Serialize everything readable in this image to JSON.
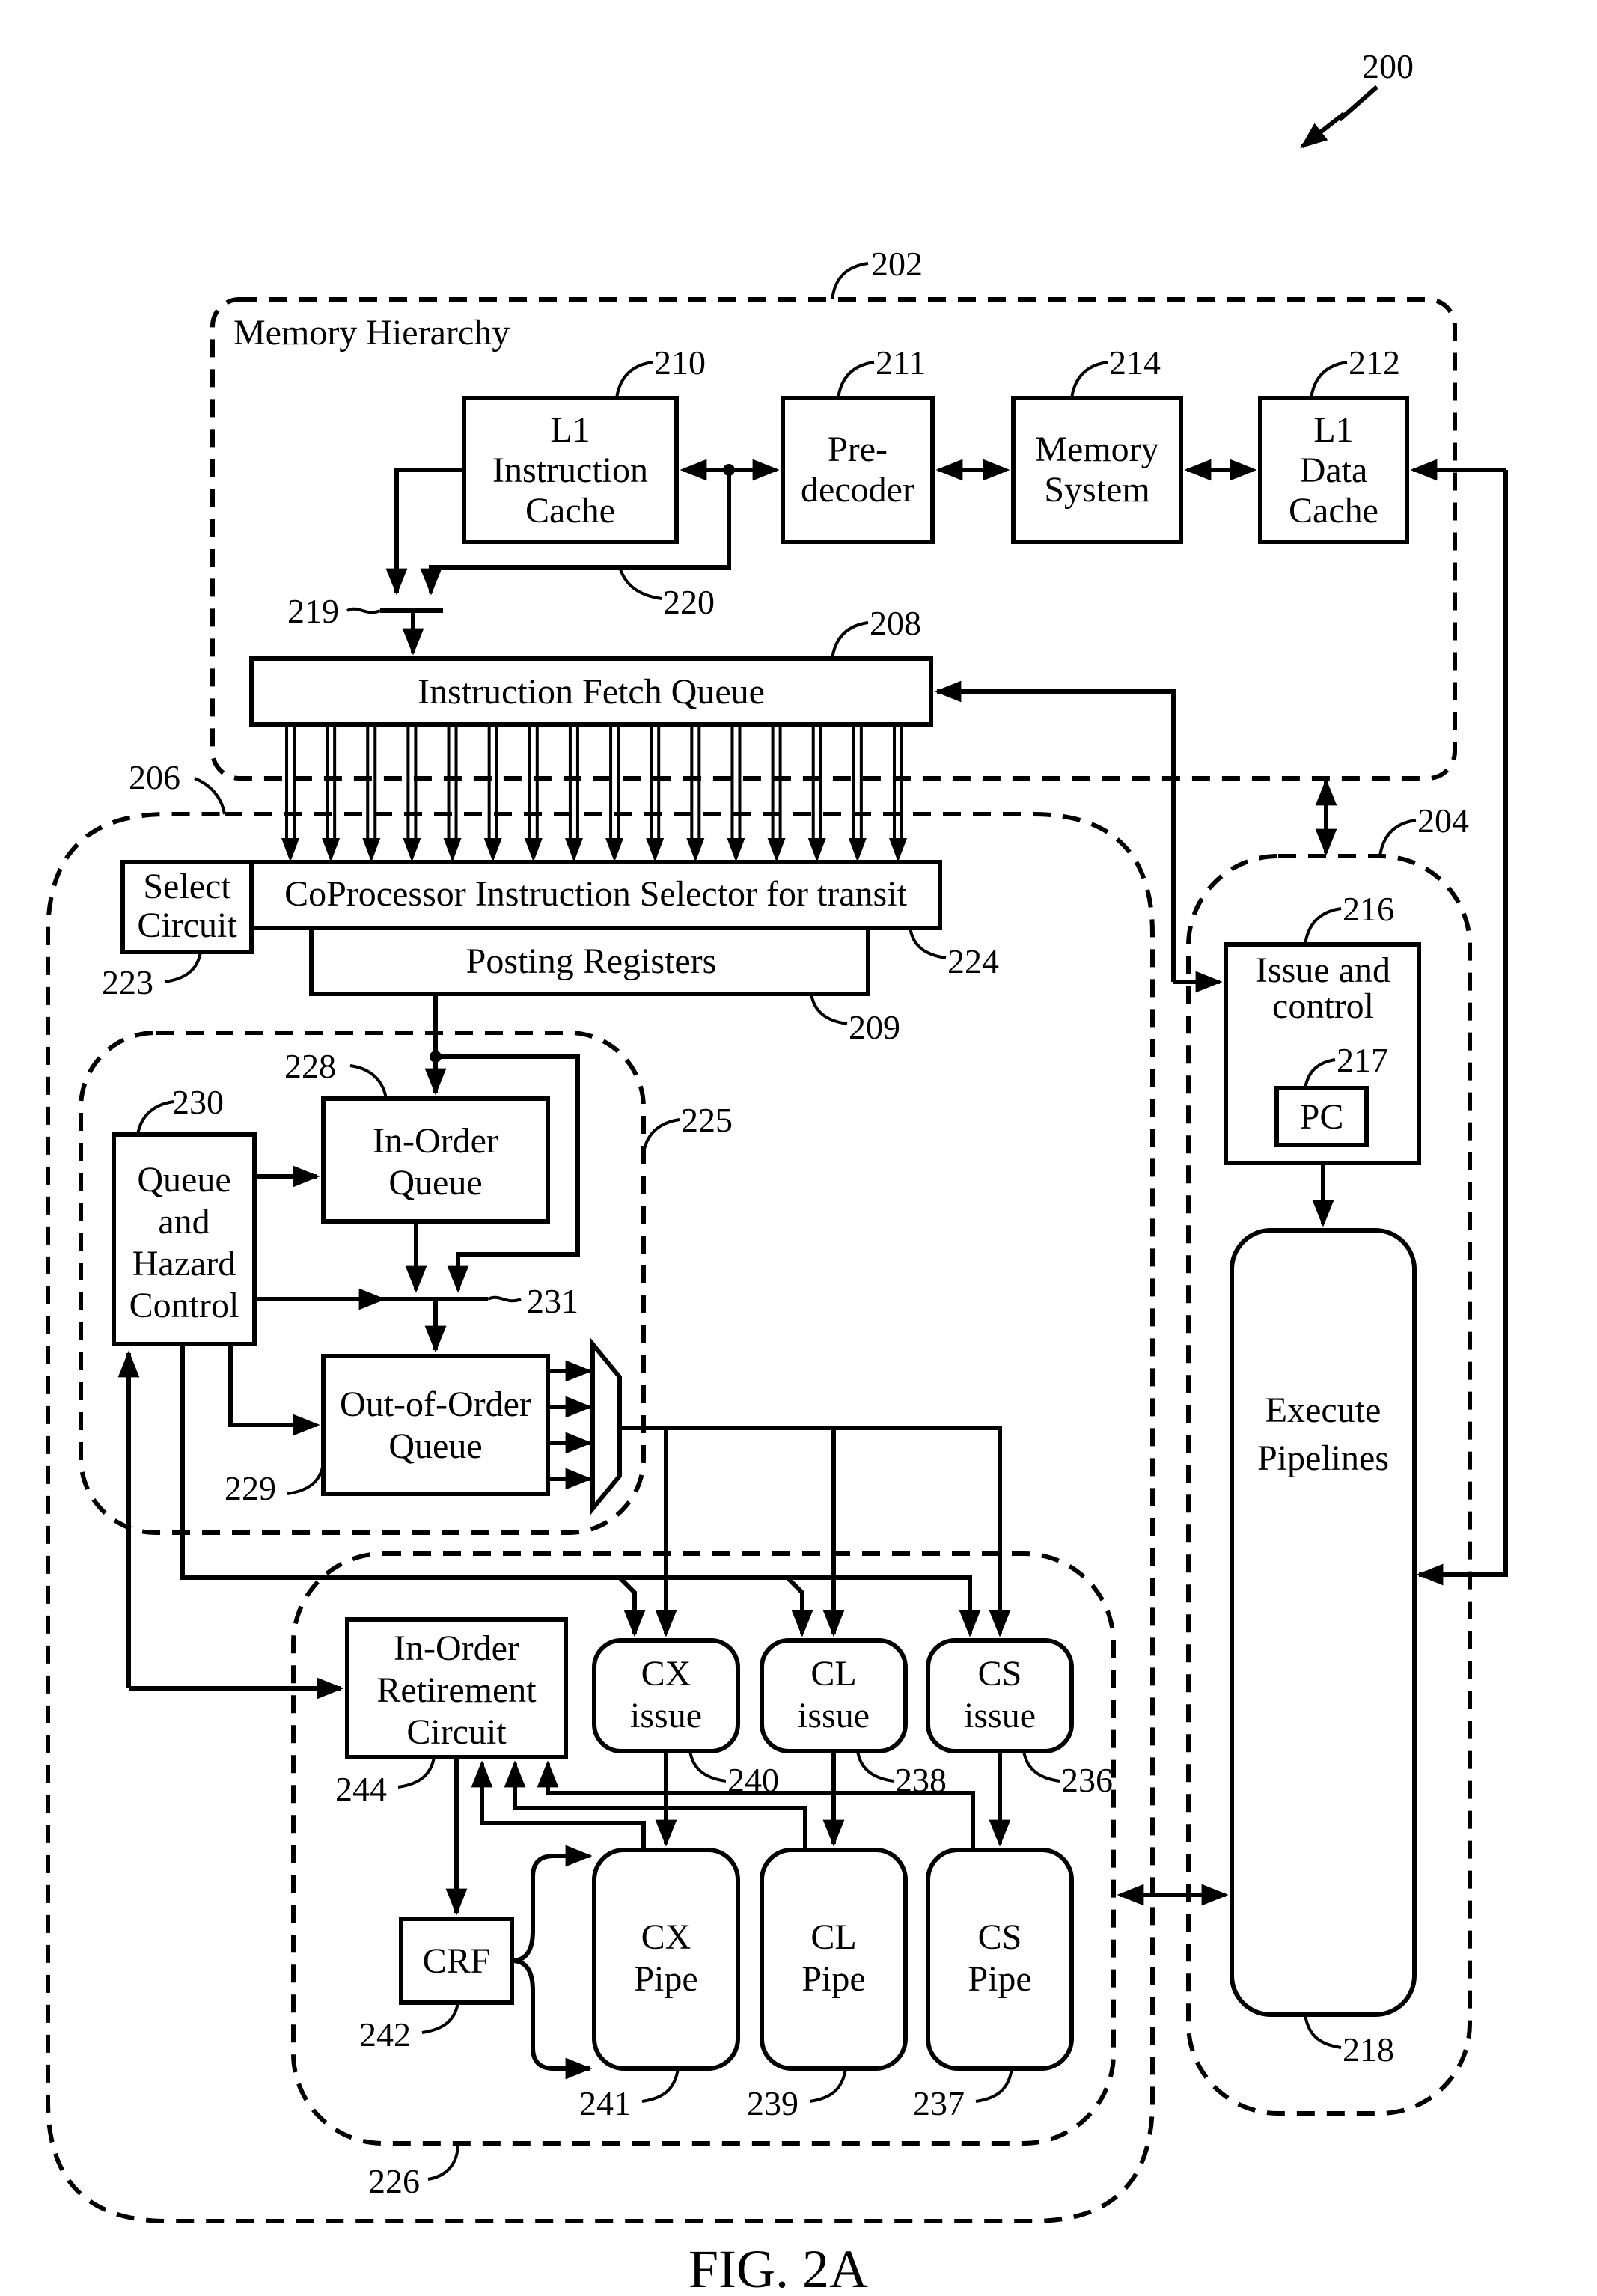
{
  "figure": {
    "caption": "FIG. 2A",
    "reference": "200"
  },
  "regions": {
    "memory_hierarchy": {
      "title": "Memory Hierarchy",
      "ref": "202"
    },
    "processor": {
      "ref": "204"
    },
    "coprocessor": {
      "ref": "206"
    },
    "queue_region": {
      "ref": "225"
    },
    "execution_region": {
      "ref": "226"
    }
  },
  "blocks": {
    "l1_icache": {
      "lines": [
        "L1",
        "Instruction",
        "Cache"
      ],
      "ref": "210"
    },
    "predecoder": {
      "lines": [
        "Pre-",
        "decoder"
      ],
      "ref": "211"
    },
    "memory_system": {
      "lines": [
        "Memory",
        "System"
      ],
      "ref": "214"
    },
    "l1_dcache": {
      "lines": [
        "L1",
        "Data",
        "Cache"
      ],
      "ref": "212"
    },
    "ifq": {
      "label": "Instruction Fetch Queue",
      "ref": "208"
    },
    "mux_219": {
      "ref": "219"
    },
    "bus_220": {
      "ref": "220"
    },
    "select_circuit": {
      "lines": [
        "Select",
        "Circuit"
      ],
      "ref": "223"
    },
    "selector": {
      "label": "CoProcessor Instruction Selector for transit",
      "ref": "224"
    },
    "posting_registers": {
      "label": "Posting Registers",
      "ref": "209"
    },
    "in_order_queue": {
      "lines": [
        "In-Order",
        "Queue"
      ],
      "ref": "228"
    },
    "ooo_queue": {
      "lines": [
        "Out-of-Order",
        "Queue"
      ],
      "ref": "229"
    },
    "queue_hazard": {
      "lines": [
        "Queue",
        "and",
        "Hazard",
        "Control"
      ],
      "ref": "230"
    },
    "mux_231": {
      "ref": "231"
    },
    "issue_control": {
      "lines": [
        "Issue and",
        "control"
      ],
      "ref": "216"
    },
    "pc": {
      "label": "PC",
      "ref": "217"
    },
    "execute_pipelines": {
      "lines": [
        "Execute",
        "Pipelines"
      ],
      "ref": "218"
    },
    "retirement": {
      "lines": [
        "In-Order",
        "Retirement",
        "Circuit"
      ],
      "ref": "244"
    },
    "crf": {
      "label": "CRF",
      "ref": "242"
    },
    "cx_issue": {
      "lines": [
        "CX",
        "issue"
      ],
      "ref": "240"
    },
    "cl_issue": {
      "lines": [
        "CL",
        "issue"
      ],
      "ref": "238"
    },
    "cs_issue": {
      "lines": [
        "CS",
        "issue"
      ],
      "ref": "236"
    },
    "cx_pipe": {
      "lines": [
        "CX",
        "Pipe"
      ],
      "ref": "241"
    },
    "cl_pipe": {
      "lines": [
        "CL",
        "Pipe"
      ],
      "ref": "239"
    },
    "cs_pipe": {
      "lines": [
        "CS",
        "Pipe"
      ],
      "ref": "237"
    }
  },
  "fetch_lanes": 16
}
